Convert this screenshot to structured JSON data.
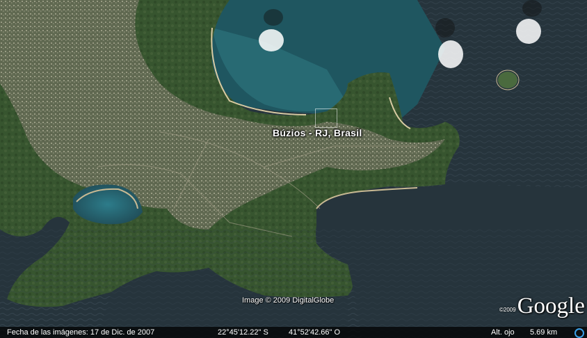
{
  "place": {
    "label": "Búzios - RJ, Brasil"
  },
  "credits": {
    "imagery": "Image © 2009 DigitalGlobe"
  },
  "logo": {
    "copyright": "©2009",
    "wordmark": "Google"
  },
  "status_bar": {
    "imagery_date": "Fecha de las imágenes: 17 de Dic. de 2007",
    "latitude": "22°45'12.22\" S",
    "longitude": "41°52'42.66\" O",
    "altitude_label": "Alt. ojo",
    "altitude_value": "5.69 km"
  },
  "colors": {
    "ocean": "#26343c",
    "shallow_water": "#2f6f7a",
    "vegetation": "#3b5a34",
    "urban": "#8a8a7a",
    "sand": "#c8b993",
    "streaming_indicator": "#3aa0e8"
  },
  "icons": {
    "streaming": "streaming-progress-icon"
  }
}
